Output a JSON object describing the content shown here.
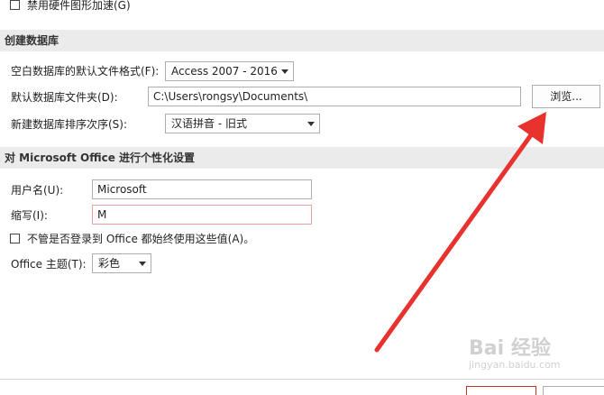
{
  "top_option": {
    "label": "禁用硬件图形加速(G)"
  },
  "create_db_section": {
    "title": "创建数据库",
    "format_label": "空白数据库的默认文件格式(F):",
    "format_value": "Access 2007 - 2016",
    "folder_label": "默认数据库文件夹(D):",
    "folder_value": "C:\\Users\\rongsy\\Documents\\",
    "browse_label": "浏览...",
    "sort_label": "新建数据库排序次序(S):",
    "sort_value": "汉语拼音 - 旧式"
  },
  "personalize_section": {
    "title": "对 Microsoft Office 进行个性化设置",
    "username_label": "用户名(U):",
    "username_value": "Microsoft",
    "initials_label": "缩写(I):",
    "initials_value": "M",
    "always_use_label": "不管是否登录到 Office 都始终使用这些值(A)。",
    "theme_label": "Office 主题(T):",
    "theme_value": "彩色"
  },
  "watermark": {
    "text": "Bai 经验",
    "sub": "jingyan.baidu.com"
  },
  "colors": {
    "arrow": "#e8322e",
    "section_bg": "#ebebeb"
  }
}
